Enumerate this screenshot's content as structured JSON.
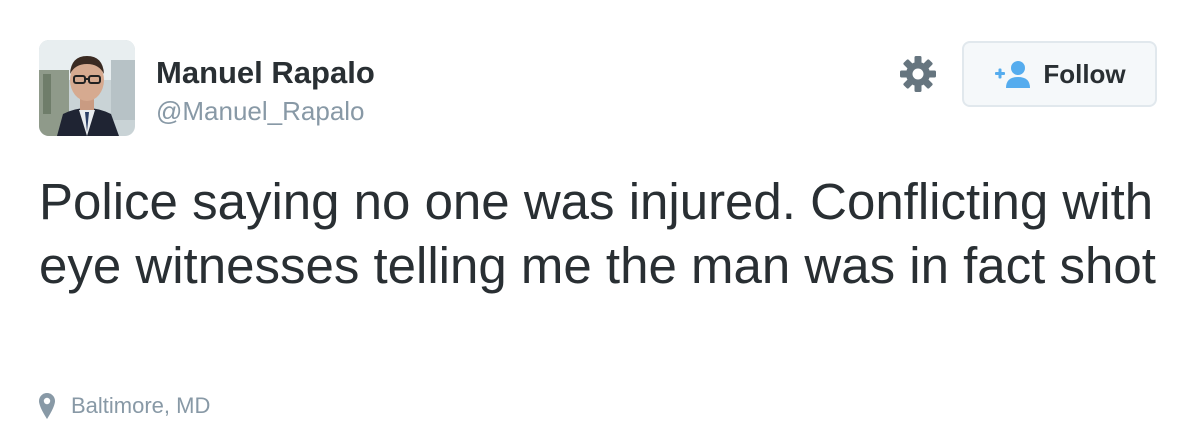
{
  "author": {
    "name": "Manuel Rapalo",
    "handle": "@Manuel_Rapalo",
    "avatar_icon": "user-photo"
  },
  "actions": {
    "settings_icon": "gear-icon",
    "follow_icon": "add-user-icon",
    "follow_label": "Follow"
  },
  "tweet": {
    "text": "Police saying no one was injured. Conflicting with eye witnesses telling me the man was in fact shot"
  },
  "location": {
    "icon": "location-pin-icon",
    "label": "Baltimore, MD"
  },
  "colors": {
    "text": "#292f33",
    "muted": "#8899a6",
    "accent": "#55acee",
    "button_border": "#e1e8ed",
    "button_bg": "#f5f8fa"
  }
}
